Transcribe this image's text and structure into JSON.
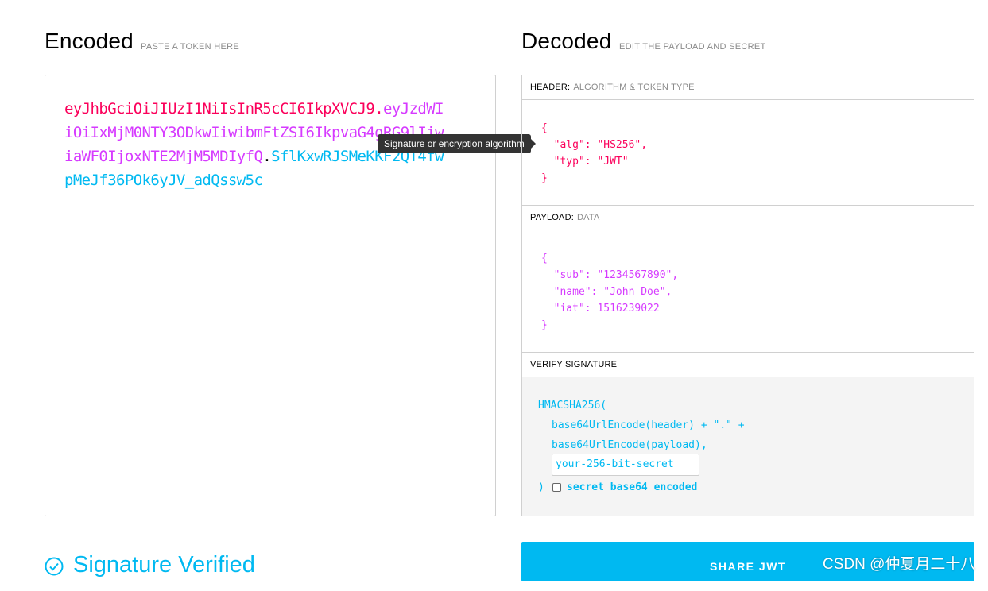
{
  "encoded": {
    "title": "Encoded",
    "subtitle": "PASTE A TOKEN HERE",
    "token_header": "eyJhbGciOiJIUzI1NiIsInR5cCI6IkpXVCJ9",
    "token_payload": "eyJzdWIiOiIxMjM0NTY3ODkwIiwibmFtZSI6IkpvaG4gRG9lIiwiaWF0IjoxNTE2MjM5MDIyfQ",
    "token_signature": "SflKxwRJSMeKKF2QT4fwpMeJf36POk6yJV_adQssw5c",
    "dot": "."
  },
  "tooltip": "Signature or encryption algorithm",
  "decoded": {
    "title": "Decoded",
    "subtitle": "EDIT THE PAYLOAD AND SECRET",
    "header_section": {
      "label": "HEADER:",
      "sublabel": "ALGORITHM & TOKEN TYPE",
      "lines": [
        "{",
        "  \"alg\": \"HS256\",",
        "  \"typ\": \"JWT\"",
        "}"
      ]
    },
    "payload_section": {
      "label": "PAYLOAD:",
      "sublabel": "DATA",
      "lines": [
        "{",
        "  \"sub\": \"1234567890\",",
        "  \"name\": \"John Doe\",",
        "  \"iat\": 1516239022",
        "}"
      ]
    },
    "verify_section": {
      "label": "VERIFY SIGNATURE",
      "fn_open": "HMACSHA256(",
      "line1": "base64UrlEncode(header) + \".\" +",
      "line2": "base64UrlEncode(payload),",
      "secret_placeholder": "your-256-bit-secret",
      "fn_close": ")",
      "checkbox_label": "secret base64 encoded"
    }
  },
  "signature_verified": "Signature Verified",
  "share_button": "SHARE JWT",
  "watermark": "CSDN @仲夏月二十八",
  "colors": {
    "header": "#fb015b",
    "payload": "#d63aff",
    "signature": "#00b9f1"
  }
}
